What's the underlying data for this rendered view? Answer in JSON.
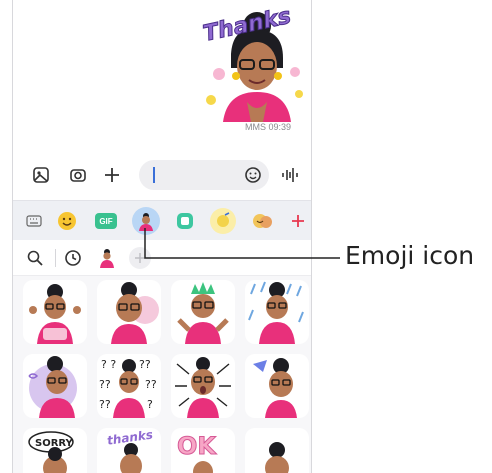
{
  "chat": {
    "sticker_text": "Thanks",
    "timestamp": "MMS 09:39"
  },
  "input_bar": {
    "icons": [
      "gallery-icon",
      "camera-icon",
      "add-icon",
      "emoji-icon",
      "voice-icon"
    ]
  },
  "categories": {
    "gif_label": "GIF",
    "items": [
      "keyboard-icon",
      "emoji-face-icon",
      "gif-icon",
      "avatar-emoji-icon",
      "sticker-icon",
      "bitmoji-icon",
      "avatar-sticker-icon",
      "add-icon"
    ],
    "selected": "avatar-emoji-icon",
    "accent_color": "#e8384f"
  },
  "sub_tools": {
    "icons": [
      "search-icon",
      "recent-clock-icon",
      "avatar-thumb-icon",
      "add-icon"
    ]
  },
  "sticker_grid": {
    "sticker_texts": [
      "SORRY",
      "thanks",
      "OK"
    ]
  },
  "callout": {
    "label": "Emoji icon"
  }
}
